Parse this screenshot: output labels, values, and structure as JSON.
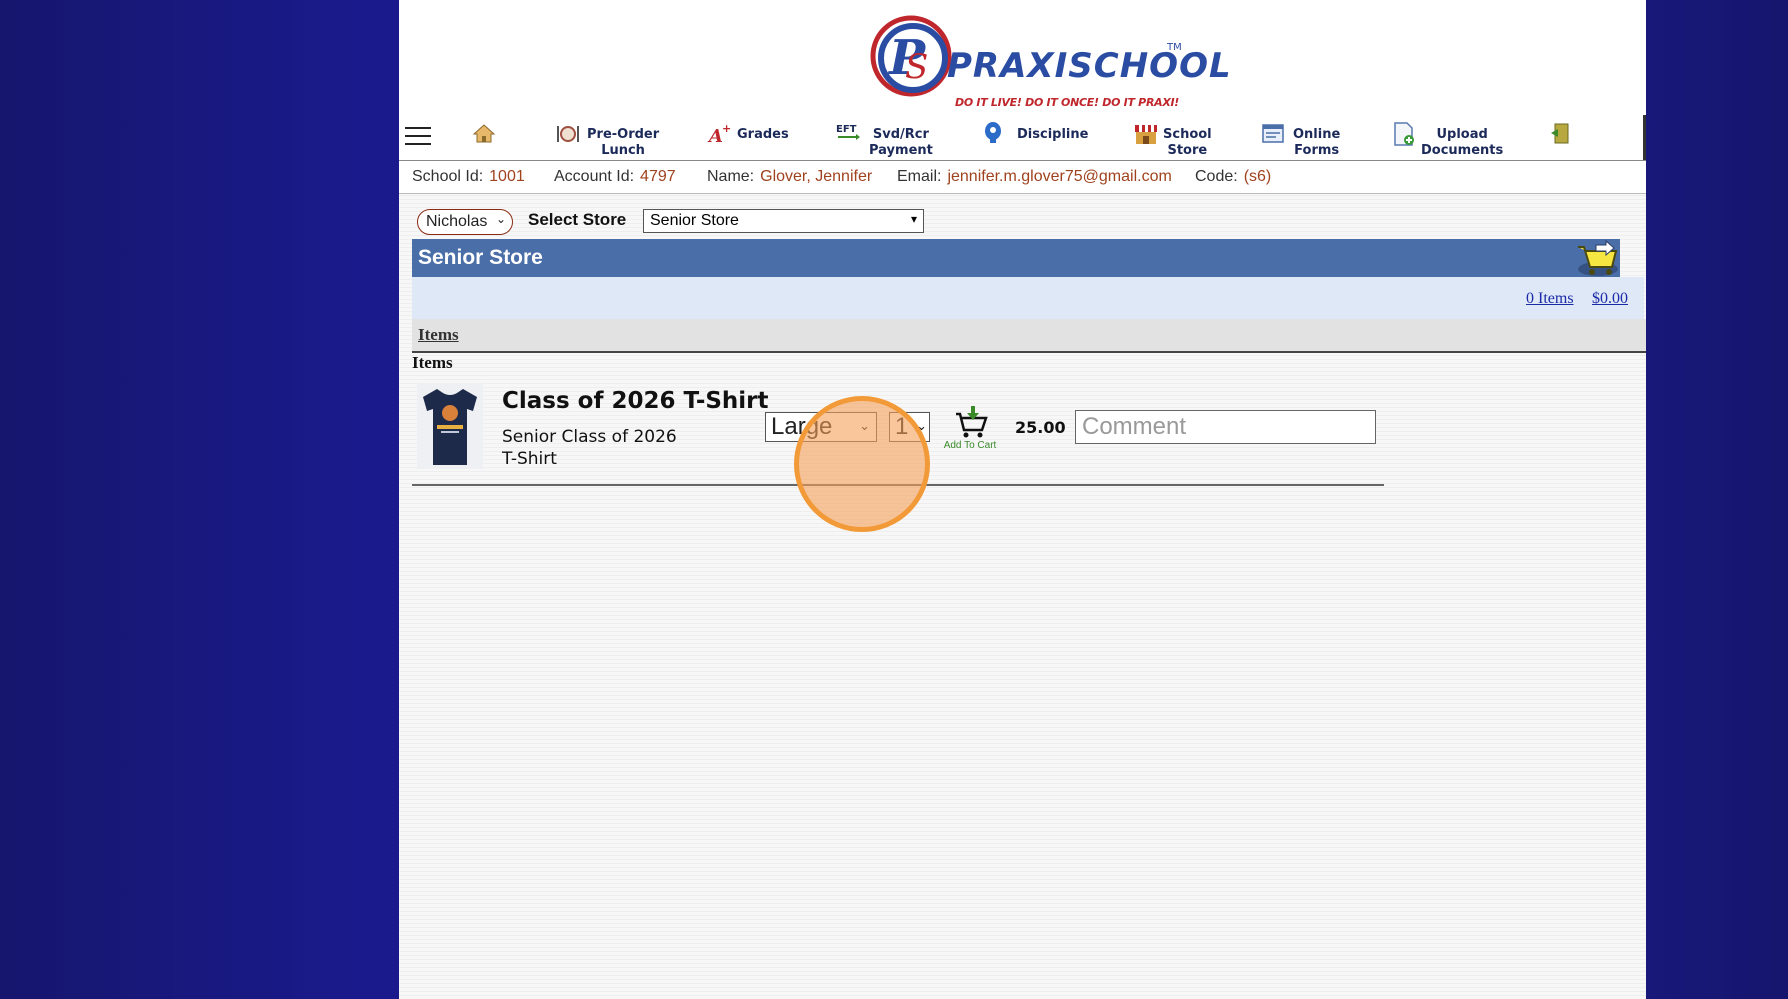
{
  "header": {
    "brand": "PRAXISCHOOL",
    "trademark": "TM",
    "tagline": "DO IT LIVE!   DO IT ONCE!   DO IT PRAXI!"
  },
  "nav": {
    "items": [
      {
        "label": "",
        "icon": "home-icon"
      },
      {
        "label": "Pre-Order\nLunch",
        "icon": "lunch-icon"
      },
      {
        "label": "Grades",
        "icon": "grades-icon"
      },
      {
        "label": "Svd/Rcr\nPayment",
        "icon": "eft-icon",
        "icon_text": "EFT"
      },
      {
        "label": "Discipline",
        "icon": "discipline-icon"
      },
      {
        "label": "School\nStore",
        "icon": "store-icon"
      },
      {
        "label": "Online\nForms",
        "icon": "forms-icon"
      },
      {
        "label": "Upload\nDocuments",
        "icon": "upload-icon"
      },
      {
        "label": "",
        "icon": "logout-icon"
      }
    ]
  },
  "account": {
    "school_id_label": "School Id:",
    "school_id": "1001",
    "account_id_label": "Account Id:",
    "account_id": "4797",
    "name_label": "Name:",
    "name": "Glover, Jennifer",
    "email_label": "Email:",
    "email": "jennifer.m.glover75@gmail.com",
    "code_label": "Code:",
    "code": "(s6)"
  },
  "store": {
    "child_selected": "Nicholas",
    "select_store_label": "Select Store",
    "store_selected": "Senior Store",
    "banner_title": "Senior Store",
    "cart_items": "0 Items",
    "cart_total": "$0.00",
    "items_tab": "Items",
    "items_heading": "Items"
  },
  "products": [
    {
      "name": "Class of 2026 T-Shirt",
      "description": "Senior Class of 2026 T-Shirt",
      "size_selected": "Large",
      "qty_selected": "1",
      "add_label": "Add To Cart",
      "price": "25.00",
      "comment_placeholder": "Comment"
    }
  ],
  "colors": {
    "banner": "#4a6ea8",
    "accent_value": "#a0421e",
    "brand_blue": "#2b4ca3",
    "tagline_red": "#c0272d",
    "cursor_highlight": "#f39a38"
  }
}
